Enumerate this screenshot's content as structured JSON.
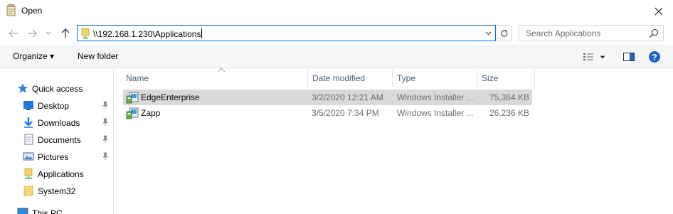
{
  "window": {
    "title": "Open",
    "close_glyph": "✕"
  },
  "address_bar": {
    "path": "\\\\192.168.1.230\\Applications"
  },
  "search": {
    "placeholder": "Search Applications"
  },
  "toolbar": {
    "organize_label": "Organize ▾",
    "new_folder_label": "New folder"
  },
  "nav_pane": {
    "items": [
      {
        "label": "Quick access",
        "icon": "star-icon"
      },
      {
        "label": "Desktop",
        "icon": "desktop-folder-icon",
        "pinned": true
      },
      {
        "label": "Downloads",
        "icon": "downloads-icon",
        "pinned": true
      },
      {
        "label": "Documents",
        "icon": "documents-icon",
        "pinned": true
      },
      {
        "label": "Pictures",
        "icon": "pictures-icon",
        "pinned": true
      },
      {
        "label": "Applications",
        "icon": "network-folder-icon"
      },
      {
        "label": "System32",
        "icon": "folder-icon"
      },
      {
        "label": "This PC",
        "icon": "computer-icon"
      }
    ]
  },
  "columns": {
    "name": "Name",
    "date_modified": "Date modified",
    "type": "Type",
    "size": "Size"
  },
  "files": [
    {
      "name": "EdgeEnterprise",
      "date_modified": "3/2/2020 12:21 AM",
      "type": "Windows Installer ...",
      "size": "75,364 KB",
      "selected": true,
      "icon": "msi-installer-icon"
    },
    {
      "name": "Zapp",
      "date_modified": "3/5/2020 7:34 PM",
      "type": "Windows Installer ...",
      "size": "26,236 KB",
      "selected": false,
      "icon": "msi-installer-icon"
    }
  ],
  "colors": {
    "accent": "#0078d7",
    "selection": "#d9d9d9",
    "header_text": "#4c607a",
    "help": "#1e62c6"
  }
}
